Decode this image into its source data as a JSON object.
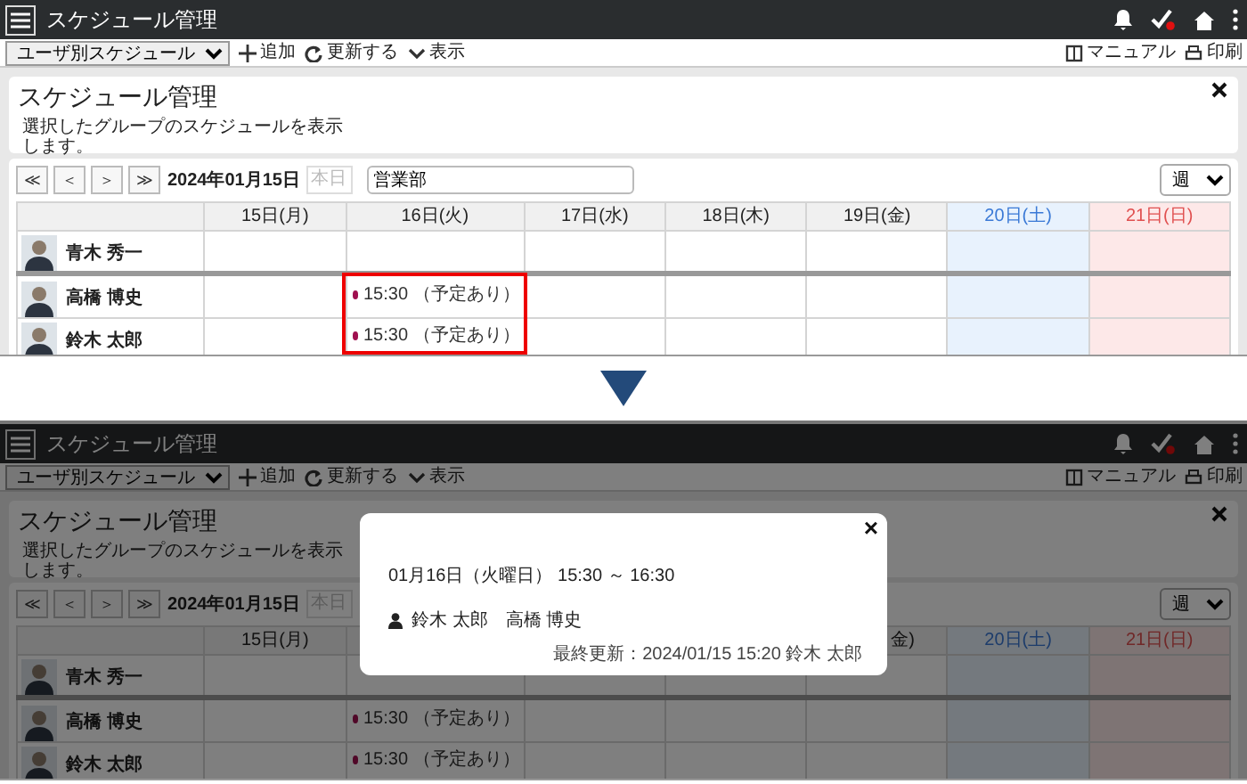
{
  "screens": [
    {
      "app_title": "スケジュール管理",
      "view_select": "ユーザ別スケジュール",
      "actions": [
        {
          "kind": "add",
          "label": "追加"
        },
        {
          "kind": "refresh",
          "label": "更新する"
        },
        {
          "kind": "show",
          "label": "表示"
        }
      ],
      "links": [
        {
          "kind": "manual",
          "label": "マニュアル"
        },
        {
          "kind": "print",
          "label": "印刷"
        }
      ],
      "panel": {
        "title": "スケジュール管理",
        "description": "選択したグループのスケジュールを表示します。"
      },
      "date": "2024年01月15日",
      "today_button": {
        "label": "本日",
        "disabled": true
      },
      "group": "営業部",
      "range_select": "週",
      "nav_buttons": [
        "≪",
        "＜",
        "＞",
        "≫"
      ],
      "days": [
        {
          "label": "15日(月)",
          "kind": "weekday"
        },
        {
          "label": "16日(火)",
          "kind": "weekday"
        },
        {
          "label": "17日(水)",
          "kind": "weekday"
        },
        {
          "label": "18日(木)",
          "kind": "weekday"
        },
        {
          "label": "19日(金)",
          "kind": "weekday"
        },
        {
          "label": "20日(土)",
          "kind": "saturday"
        },
        {
          "label": "21日(日)",
          "kind": "sunday"
        }
      ],
      "users": [
        {
          "name": "青木 秀一",
          "cells": [
            {
              "kind": "empty"
            },
            {
              "kind": "empty"
            },
            {
              "kind": "empty"
            },
            {
              "kind": "empty"
            },
            {
              "kind": "empty"
            },
            {
              "kind": "empty"
            },
            {
              "kind": "empty"
            }
          ]
        },
        {
          "name": "高橋 博史",
          "cells": [
            {
              "kind": "empty"
            },
            {
              "kind": "event",
              "text": "15:30 （予定あり）",
              "highlighted": true
            },
            {
              "kind": "empty"
            },
            {
              "kind": "empty"
            },
            {
              "kind": "empty"
            },
            {
              "kind": "empty"
            },
            {
              "kind": "empty"
            }
          ]
        },
        {
          "name": "鈴木 太郎",
          "cells": [
            {
              "kind": "empty"
            },
            {
              "kind": "event",
              "text": "15:30 （予定あり）",
              "highlighted": true
            },
            {
              "kind": "empty"
            },
            {
              "kind": "empty"
            },
            {
              "kind": "empty"
            },
            {
              "kind": "empty"
            },
            {
              "kind": "empty"
            }
          ]
        }
      ],
      "dimmed": false
    },
    {
      "app_title": "スケジュール管理",
      "view_select": "ユーザ別スケジュール",
      "actions": [
        {
          "kind": "add",
          "label": "追加"
        },
        {
          "kind": "refresh",
          "label": "更新する"
        },
        {
          "kind": "show",
          "label": "表示"
        }
      ],
      "links": [
        {
          "kind": "manual",
          "label": "マニュアル"
        },
        {
          "kind": "print",
          "label": "印刷"
        }
      ],
      "panel": {
        "title": "スケジュール管理",
        "description": "選択したグループのスケジュールを表示します。"
      },
      "date": "2024年01月15日",
      "today_button": {
        "label": "本日",
        "disabled": true
      },
      "range_select": "週",
      "nav_buttons": [
        "≪",
        "＜",
        "＞",
        "≫"
      ],
      "days": [
        {
          "label": "15日(月)",
          "kind": "weekday"
        },
        {
          "kind": "weekday"
        },
        {
          "kind": "weekday"
        },
        {
          "kind": "weekday"
        },
        {
          "label": "金)",
          "kind": "weekday",
          "clipped": true
        },
        {
          "label": "20日(土)",
          "kind": "saturday"
        },
        {
          "label": "21日(日)",
          "kind": "sunday"
        }
      ],
      "users": [
        {
          "name": "青木 秀一",
          "cells": [
            {
              "kind": "empty"
            },
            {
              "kind": "empty"
            },
            {
              "kind": "empty"
            },
            {
              "kind": "empty"
            },
            {
              "kind": "empty"
            },
            {
              "kind": "empty"
            },
            {
              "kind": "empty"
            }
          ]
        },
        {
          "name": "高橋 博史",
          "cells": [
            {
              "kind": "empty"
            },
            {
              "kind": "event",
              "text": "15:30 （予定あり）",
              "highlighted": false
            },
            {
              "kind": "empty"
            },
            {
              "kind": "empty"
            },
            {
              "kind": "empty"
            },
            {
              "kind": "empty"
            },
            {
              "kind": "empty"
            }
          ]
        },
        {
          "name": "鈴木 太郎",
          "cells": [
            {
              "kind": "empty"
            },
            {
              "kind": "event",
              "text": "15:30 （予定あり）",
              "highlighted": false
            },
            {
              "kind": "empty"
            },
            {
              "kind": "empty"
            },
            {
              "kind": "empty"
            },
            {
              "kind": "empty"
            },
            {
              "kind": "empty"
            }
          ]
        }
      ],
      "dimmed": true,
      "dialog": {
        "close": "×",
        "when": "01月16日（火曜日） 15:30 ～ 16:30",
        "participants": "鈴木 太郎　高橋 博史",
        "updated": "最終更新：2024/01/15 15:20 鈴木 太郎"
      }
    }
  ]
}
